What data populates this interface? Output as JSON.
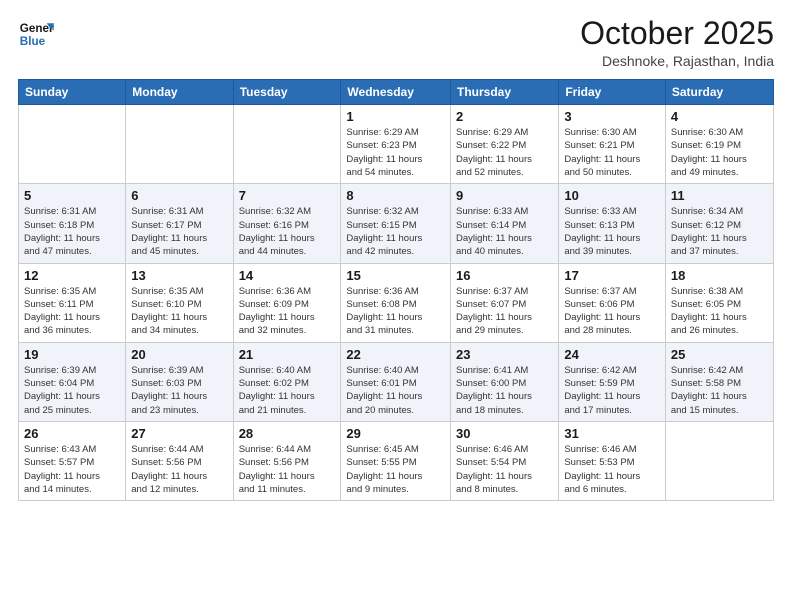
{
  "header": {
    "logo_general": "General",
    "logo_blue": "Blue",
    "month_title": "October 2025",
    "location": "Deshnoke, Rajasthan, India"
  },
  "weekdays": [
    "Sunday",
    "Monday",
    "Tuesday",
    "Wednesday",
    "Thursday",
    "Friday",
    "Saturday"
  ],
  "weeks": [
    [
      {
        "day": "",
        "sunrise": "",
        "sunset": "",
        "daylight": ""
      },
      {
        "day": "",
        "sunrise": "",
        "sunset": "",
        "daylight": ""
      },
      {
        "day": "",
        "sunrise": "",
        "sunset": "",
        "daylight": ""
      },
      {
        "day": "1",
        "sunrise": "Sunrise: 6:29 AM",
        "sunset": "Sunset: 6:23 PM",
        "daylight": "Daylight: 11 hours and 54 minutes."
      },
      {
        "day": "2",
        "sunrise": "Sunrise: 6:29 AM",
        "sunset": "Sunset: 6:22 PM",
        "daylight": "Daylight: 11 hours and 52 minutes."
      },
      {
        "day": "3",
        "sunrise": "Sunrise: 6:30 AM",
        "sunset": "Sunset: 6:21 PM",
        "daylight": "Daylight: 11 hours and 50 minutes."
      },
      {
        "day": "4",
        "sunrise": "Sunrise: 6:30 AM",
        "sunset": "Sunset: 6:19 PM",
        "daylight": "Daylight: 11 hours and 49 minutes."
      }
    ],
    [
      {
        "day": "5",
        "sunrise": "Sunrise: 6:31 AM",
        "sunset": "Sunset: 6:18 PM",
        "daylight": "Daylight: 11 hours and 47 minutes."
      },
      {
        "day": "6",
        "sunrise": "Sunrise: 6:31 AM",
        "sunset": "Sunset: 6:17 PM",
        "daylight": "Daylight: 11 hours and 45 minutes."
      },
      {
        "day": "7",
        "sunrise": "Sunrise: 6:32 AM",
        "sunset": "Sunset: 6:16 PM",
        "daylight": "Daylight: 11 hours and 44 minutes."
      },
      {
        "day": "8",
        "sunrise": "Sunrise: 6:32 AM",
        "sunset": "Sunset: 6:15 PM",
        "daylight": "Daylight: 11 hours and 42 minutes."
      },
      {
        "day": "9",
        "sunrise": "Sunrise: 6:33 AM",
        "sunset": "Sunset: 6:14 PM",
        "daylight": "Daylight: 11 hours and 40 minutes."
      },
      {
        "day": "10",
        "sunrise": "Sunrise: 6:33 AM",
        "sunset": "Sunset: 6:13 PM",
        "daylight": "Daylight: 11 hours and 39 minutes."
      },
      {
        "day": "11",
        "sunrise": "Sunrise: 6:34 AM",
        "sunset": "Sunset: 6:12 PM",
        "daylight": "Daylight: 11 hours and 37 minutes."
      }
    ],
    [
      {
        "day": "12",
        "sunrise": "Sunrise: 6:35 AM",
        "sunset": "Sunset: 6:11 PM",
        "daylight": "Daylight: 11 hours and 36 minutes."
      },
      {
        "day": "13",
        "sunrise": "Sunrise: 6:35 AM",
        "sunset": "Sunset: 6:10 PM",
        "daylight": "Daylight: 11 hours and 34 minutes."
      },
      {
        "day": "14",
        "sunrise": "Sunrise: 6:36 AM",
        "sunset": "Sunset: 6:09 PM",
        "daylight": "Daylight: 11 hours and 32 minutes."
      },
      {
        "day": "15",
        "sunrise": "Sunrise: 6:36 AM",
        "sunset": "Sunset: 6:08 PM",
        "daylight": "Daylight: 11 hours and 31 minutes."
      },
      {
        "day": "16",
        "sunrise": "Sunrise: 6:37 AM",
        "sunset": "Sunset: 6:07 PM",
        "daylight": "Daylight: 11 hours and 29 minutes."
      },
      {
        "day": "17",
        "sunrise": "Sunrise: 6:37 AM",
        "sunset": "Sunset: 6:06 PM",
        "daylight": "Daylight: 11 hours and 28 minutes."
      },
      {
        "day": "18",
        "sunrise": "Sunrise: 6:38 AM",
        "sunset": "Sunset: 6:05 PM",
        "daylight": "Daylight: 11 hours and 26 minutes."
      }
    ],
    [
      {
        "day": "19",
        "sunrise": "Sunrise: 6:39 AM",
        "sunset": "Sunset: 6:04 PM",
        "daylight": "Daylight: 11 hours and 25 minutes."
      },
      {
        "day": "20",
        "sunrise": "Sunrise: 6:39 AM",
        "sunset": "Sunset: 6:03 PM",
        "daylight": "Daylight: 11 hours and 23 minutes."
      },
      {
        "day": "21",
        "sunrise": "Sunrise: 6:40 AM",
        "sunset": "Sunset: 6:02 PM",
        "daylight": "Daylight: 11 hours and 21 minutes."
      },
      {
        "day": "22",
        "sunrise": "Sunrise: 6:40 AM",
        "sunset": "Sunset: 6:01 PM",
        "daylight": "Daylight: 11 hours and 20 minutes."
      },
      {
        "day": "23",
        "sunrise": "Sunrise: 6:41 AM",
        "sunset": "Sunset: 6:00 PM",
        "daylight": "Daylight: 11 hours and 18 minutes."
      },
      {
        "day": "24",
        "sunrise": "Sunrise: 6:42 AM",
        "sunset": "Sunset: 5:59 PM",
        "daylight": "Daylight: 11 hours and 17 minutes."
      },
      {
        "day": "25",
        "sunrise": "Sunrise: 6:42 AM",
        "sunset": "Sunset: 5:58 PM",
        "daylight": "Daylight: 11 hours and 15 minutes."
      }
    ],
    [
      {
        "day": "26",
        "sunrise": "Sunrise: 6:43 AM",
        "sunset": "Sunset: 5:57 PM",
        "daylight": "Daylight: 11 hours and 14 minutes."
      },
      {
        "day": "27",
        "sunrise": "Sunrise: 6:44 AM",
        "sunset": "Sunset: 5:56 PM",
        "daylight": "Daylight: 11 hours and 12 minutes."
      },
      {
        "day": "28",
        "sunrise": "Sunrise: 6:44 AM",
        "sunset": "Sunset: 5:56 PM",
        "daylight": "Daylight: 11 hours and 11 minutes."
      },
      {
        "day": "29",
        "sunrise": "Sunrise: 6:45 AM",
        "sunset": "Sunset: 5:55 PM",
        "daylight": "Daylight: 11 hours and 9 minutes."
      },
      {
        "day": "30",
        "sunrise": "Sunrise: 6:46 AM",
        "sunset": "Sunset: 5:54 PM",
        "daylight": "Daylight: 11 hours and 8 minutes."
      },
      {
        "day": "31",
        "sunrise": "Sunrise: 6:46 AM",
        "sunset": "Sunset: 5:53 PM",
        "daylight": "Daylight: 11 hours and 6 minutes."
      },
      {
        "day": "",
        "sunrise": "",
        "sunset": "",
        "daylight": ""
      }
    ]
  ]
}
